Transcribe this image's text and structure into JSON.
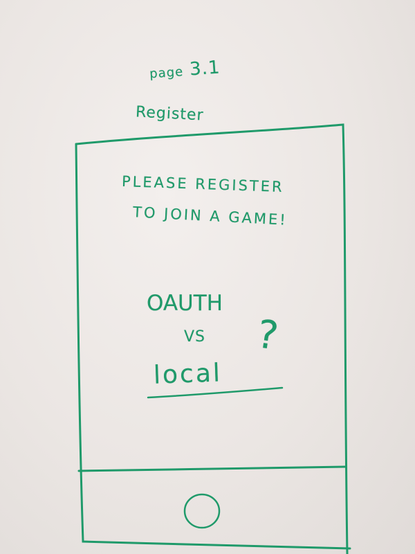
{
  "page_label": {
    "prefix": "page",
    "number": "3.1"
  },
  "screen_title": "Register",
  "phone": {
    "prompt_line_1": "PLEASE REGISTER",
    "prompt_line_2": "TO JOIN A GAME!",
    "option_1": "OAUTH",
    "connector": "VS",
    "option_2": "local",
    "question_mark": "?"
  },
  "colors": {
    "marker": "#1f9a6a",
    "whiteboard": "#ebe6e3"
  },
  "icons": {
    "home_button": "circle-home-button-icon"
  }
}
